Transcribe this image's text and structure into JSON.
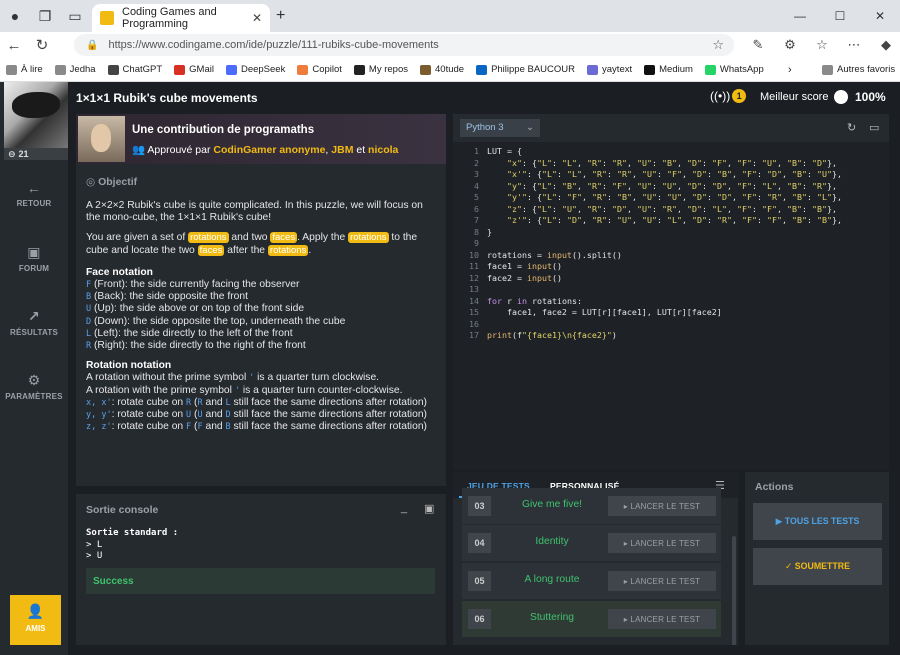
{
  "browser": {
    "tab_title": "Coding Games and Programming",
    "url": "https://www.codingame.com/ide/puzzle/111-rubiks-cube-movements",
    "bookmarks": [
      {
        "label": "À lire",
        "color": "#8a8a8a"
      },
      {
        "label": "Jedha",
        "color": "#8a8a8a"
      },
      {
        "label": "ChatGPT",
        "color": "#444444"
      },
      {
        "label": "GMail",
        "color": "#d93025"
      },
      {
        "label": "DeepSeek",
        "color": "#4d6bfe"
      },
      {
        "label": "Copilot",
        "color": "#f07c3c"
      },
      {
        "label": "My repos",
        "color": "#222222"
      },
      {
        "label": "40tude",
        "color": "#7a5c2e"
      },
      {
        "label": "Philippe BAUCOUR",
        "color": "#0a66c2"
      },
      {
        "label": "yaytext",
        "color": "#6b6bd6"
      },
      {
        "label": "Medium",
        "color": "#111111"
      },
      {
        "label": "WhatsApp",
        "color": "#25d366"
      }
    ],
    "other_bookmarks": "Autres favoris"
  },
  "nav": {
    "level": "21",
    "retour": "RETOUR",
    "forum": "FORUM",
    "resultats": "RÉSULTATS",
    "parametres": "PARAMÈTRES",
    "amis": "AMIS"
  },
  "header": {
    "title": "1×1×1 Rubik's cube movements",
    "rank": "1",
    "best_label": "Meilleur score",
    "best_value": "100%"
  },
  "statement": {
    "contrib_title": "Une contribution de programaths",
    "approved_prefix": "Approuvé par",
    "approver1": "CodinGamer anonyme",
    "approver2": "JBM",
    "approved_and": "et",
    "approver3": "nicola",
    "objective": "Objectif",
    "p1": "A 2×2×2 Rubik's cube is quite complicated. In this puzzle, we will focus on the mono-cube, the 1×1×1 Rubik's cube!",
    "p2a": "You are given a set of",
    "tag_rotations": "rotations",
    "p2b": "and two",
    "tag_faces": "faces",
    "p2c": ". Apply the",
    "p2d": "to the cube and locate the two",
    "p2e": "after the",
    "face_notation": "Face notation",
    "faces": [
      {
        "k": "F",
        "t": "(Front): the side currently facing the observer"
      },
      {
        "k": "B",
        "t": "(Back): the side opposite the front"
      },
      {
        "k": "U",
        "t": "(Up): the side above or on top of the front side"
      },
      {
        "k": "D",
        "t": "(Down): the side opposite the top, underneath the cube"
      },
      {
        "k": "L",
        "t": "(Left): the side directly to the left of the front"
      },
      {
        "k": "R",
        "t": "(Right): the side directly to the right of the front"
      }
    ],
    "rotation_notation": "Rotation notation",
    "r1a": "A rotation without the prime symbol",
    "r1b": "is a quarter turn clockwise.",
    "r2a": "A rotation with the prime symbol",
    "r2b": "is a quarter turn counter-clockwise.",
    "prime": "'",
    "rx_k": "x, x'",
    "rx_t": ": rotate cube on",
    "rx_a": "R",
    "rx_b": "(",
    "rx_c": "R",
    "rx_d": "and",
    "rx_e": "L",
    "rx_f": "still face the same directions after rotation)",
    "ry_k": "y, y'",
    "ry_a": "U",
    "ry_c": "U",
    "ry_e": "D",
    "ry_f": "still face the same directions after rotation)",
    "rz_k": "z, z'",
    "rz_a": "F",
    "rz_c": "F",
    "rz_e": "B",
    "rz_f": "still face the same directions after rotation)"
  },
  "console": {
    "title": "Sortie console",
    "std": "Sortie standard :",
    "out1": "> L",
    "out2": "> U",
    "success": "Success"
  },
  "editor": {
    "language": "Python 3",
    "lines": [
      "LUT = {",
      "    \"x\": {\"L\": \"L\", \"R\": \"R\", \"U\": \"B\", \"D\": \"F\", \"F\": \"U\", \"B\": \"D\"},",
      "    \"x'\": {\"L\": \"L\", \"R\": \"R\", \"U\": \"F\", \"D\": \"B\", \"F\": \"D\", \"B\": \"U\"},",
      "    \"y\": {\"L\": \"B\", \"R\": \"F\", \"U\": \"U\", \"D\": \"D\", \"F\": \"L\", \"B\": \"R\"},",
      "    \"y'\": {\"L\": \"F\", \"R\": \"B\", \"U\": \"U\", \"D\": \"D\", \"F\": \"R\", \"B\": \"L\"},",
      "    \"z\": {\"L\": \"U\", \"R\": \"D\", \"U\": \"R\", \"D\": \"L\", \"F\": \"F\", \"B\": \"B\"},",
      "    \"z'\": {\"L\": \"D\", \"R\": \"U\", \"U\": \"L\", \"D\": \"R\", \"F\": \"F\", \"B\": \"B\"},",
      "}",
      "",
      "rotations = input().split()",
      "face1 = input()",
      "face2 = input()",
      "",
      "for r in rotations:",
      "    face1, face2 = LUT[r][face1], LUT[r][face2]",
      "",
      "print(f\"{face1}\\n{face2}\")"
    ]
  },
  "tests": {
    "tab_tests": "JEU DE TESTS",
    "tab_custom": "PERSONNALISÉ",
    "run_label": "▸ LANCER LE TEST",
    "items": [
      {
        "num": "03",
        "name": "Give me five!"
      },
      {
        "num": "04",
        "name": "Identity"
      },
      {
        "num": "05",
        "name": "A long route"
      },
      {
        "num": "06",
        "name": "Stuttering"
      }
    ]
  },
  "actions": {
    "title": "Actions",
    "all_tests": "▶ TOUS LES TESTS",
    "submit": "✓ SOUMETTRE"
  }
}
